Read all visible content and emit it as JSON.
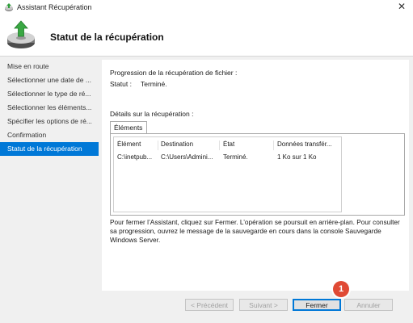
{
  "window": {
    "title": "Assistant Récupération"
  },
  "header": {
    "title": "Statut de la récupération"
  },
  "sidebar": {
    "items": [
      {
        "label": "Mise en route"
      },
      {
        "label": "Sélectionner une date de ..."
      },
      {
        "label": "Sélectionner le type de ré..."
      },
      {
        "label": "Sélectionner les éléments..."
      },
      {
        "label": "Spécifier les options de ré..."
      },
      {
        "label": "Confirmation"
      },
      {
        "label": "Statut de la récupération"
      }
    ],
    "active_index": 6
  },
  "content": {
    "progress_title": "Progression de la récupération de fichier :",
    "status_label": "Statut :",
    "status_value": "Terminé.",
    "details_title": "Détails sur la récupération :",
    "tab_label": "Éléments",
    "table": {
      "columns": [
        "Élément",
        "Destination",
        "État",
        "Données transfér..."
      ],
      "rows": [
        [
          "C:\\inetpub...",
          "C:\\Users\\Admini...",
          "Terminé.",
          "1 Ko sur 1 Ko"
        ]
      ]
    },
    "info_text": "Pour fermer l’Assistant, cliquez sur Fermer. L’opération se poursuit en arrière-plan. Pour consulter sa progression, ouvrez le message de la sauvegarde en cours dans la console Sauvegarde Windows Server."
  },
  "buttons": {
    "previous": "< Précédent",
    "next": "Suivant >",
    "close": "Fermer",
    "cancel": "Annuler"
  },
  "annotation": {
    "badge": "1"
  },
  "colors": {
    "accent": "#0078d7",
    "badge": "#e04a35"
  }
}
